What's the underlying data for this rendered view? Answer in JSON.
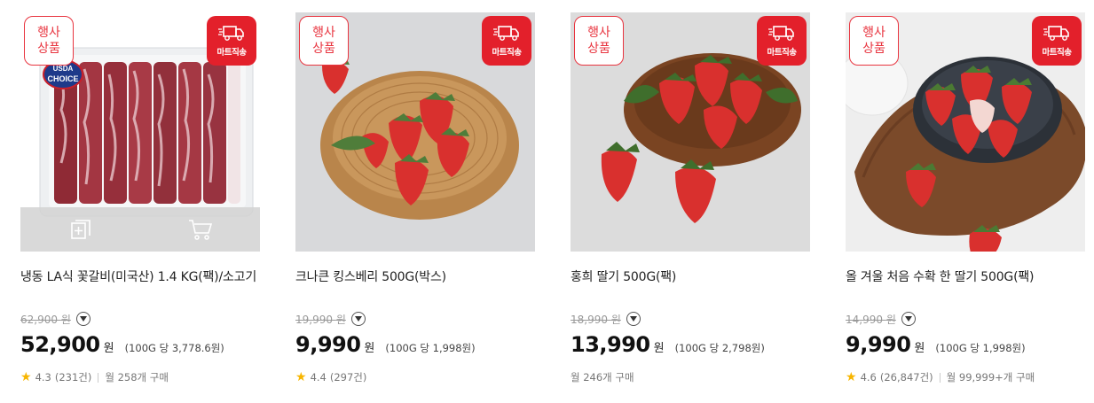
{
  "badges": {
    "event": [
      "행사",
      "상품"
    ],
    "ship_label": "마트직송"
  },
  "products": [
    {
      "name": "냉동 LA식 꽃갈비(미국산) 1.4 KG(팩)/소고기",
      "orig_price": "62,900",
      "orig_won": "원",
      "price": "52,900",
      "won": "원",
      "unit_price": "(100G 당 3,778.6원)",
      "rating": "4.3",
      "reviews": "(231건)",
      "monthly": "월 258개 구매",
      "image_badge": "USDA CHOICE"
    },
    {
      "name": "크나큰 킹스베리 500G(박스)",
      "orig_price": "19,990",
      "orig_won": "원",
      "price": "9,990",
      "won": "원",
      "unit_price": "(100G 당 1,998원)",
      "rating": "4.4",
      "reviews": "(297건)",
      "monthly": ""
    },
    {
      "name": "홍희 딸기 500G(팩)",
      "orig_price": "18,990",
      "orig_won": "원",
      "price": "13,990",
      "won": "원",
      "unit_price": "(100G 당 2,798원)",
      "rating": "",
      "reviews": "",
      "monthly": "월 246개 구매"
    },
    {
      "name": "올 겨울 처음 수확 한 딸기 500G(팩)",
      "orig_price": "14,990",
      "orig_won": "원",
      "price": "9,990",
      "won": "원",
      "unit_price": "(100G 당 1,998원)",
      "rating": "4.6",
      "reviews": "(26,847건)",
      "monthly": "월 99,999+개 구매"
    }
  ],
  "colors": {
    "accent_red": "#e3202b",
    "star": "#f7b500"
  }
}
